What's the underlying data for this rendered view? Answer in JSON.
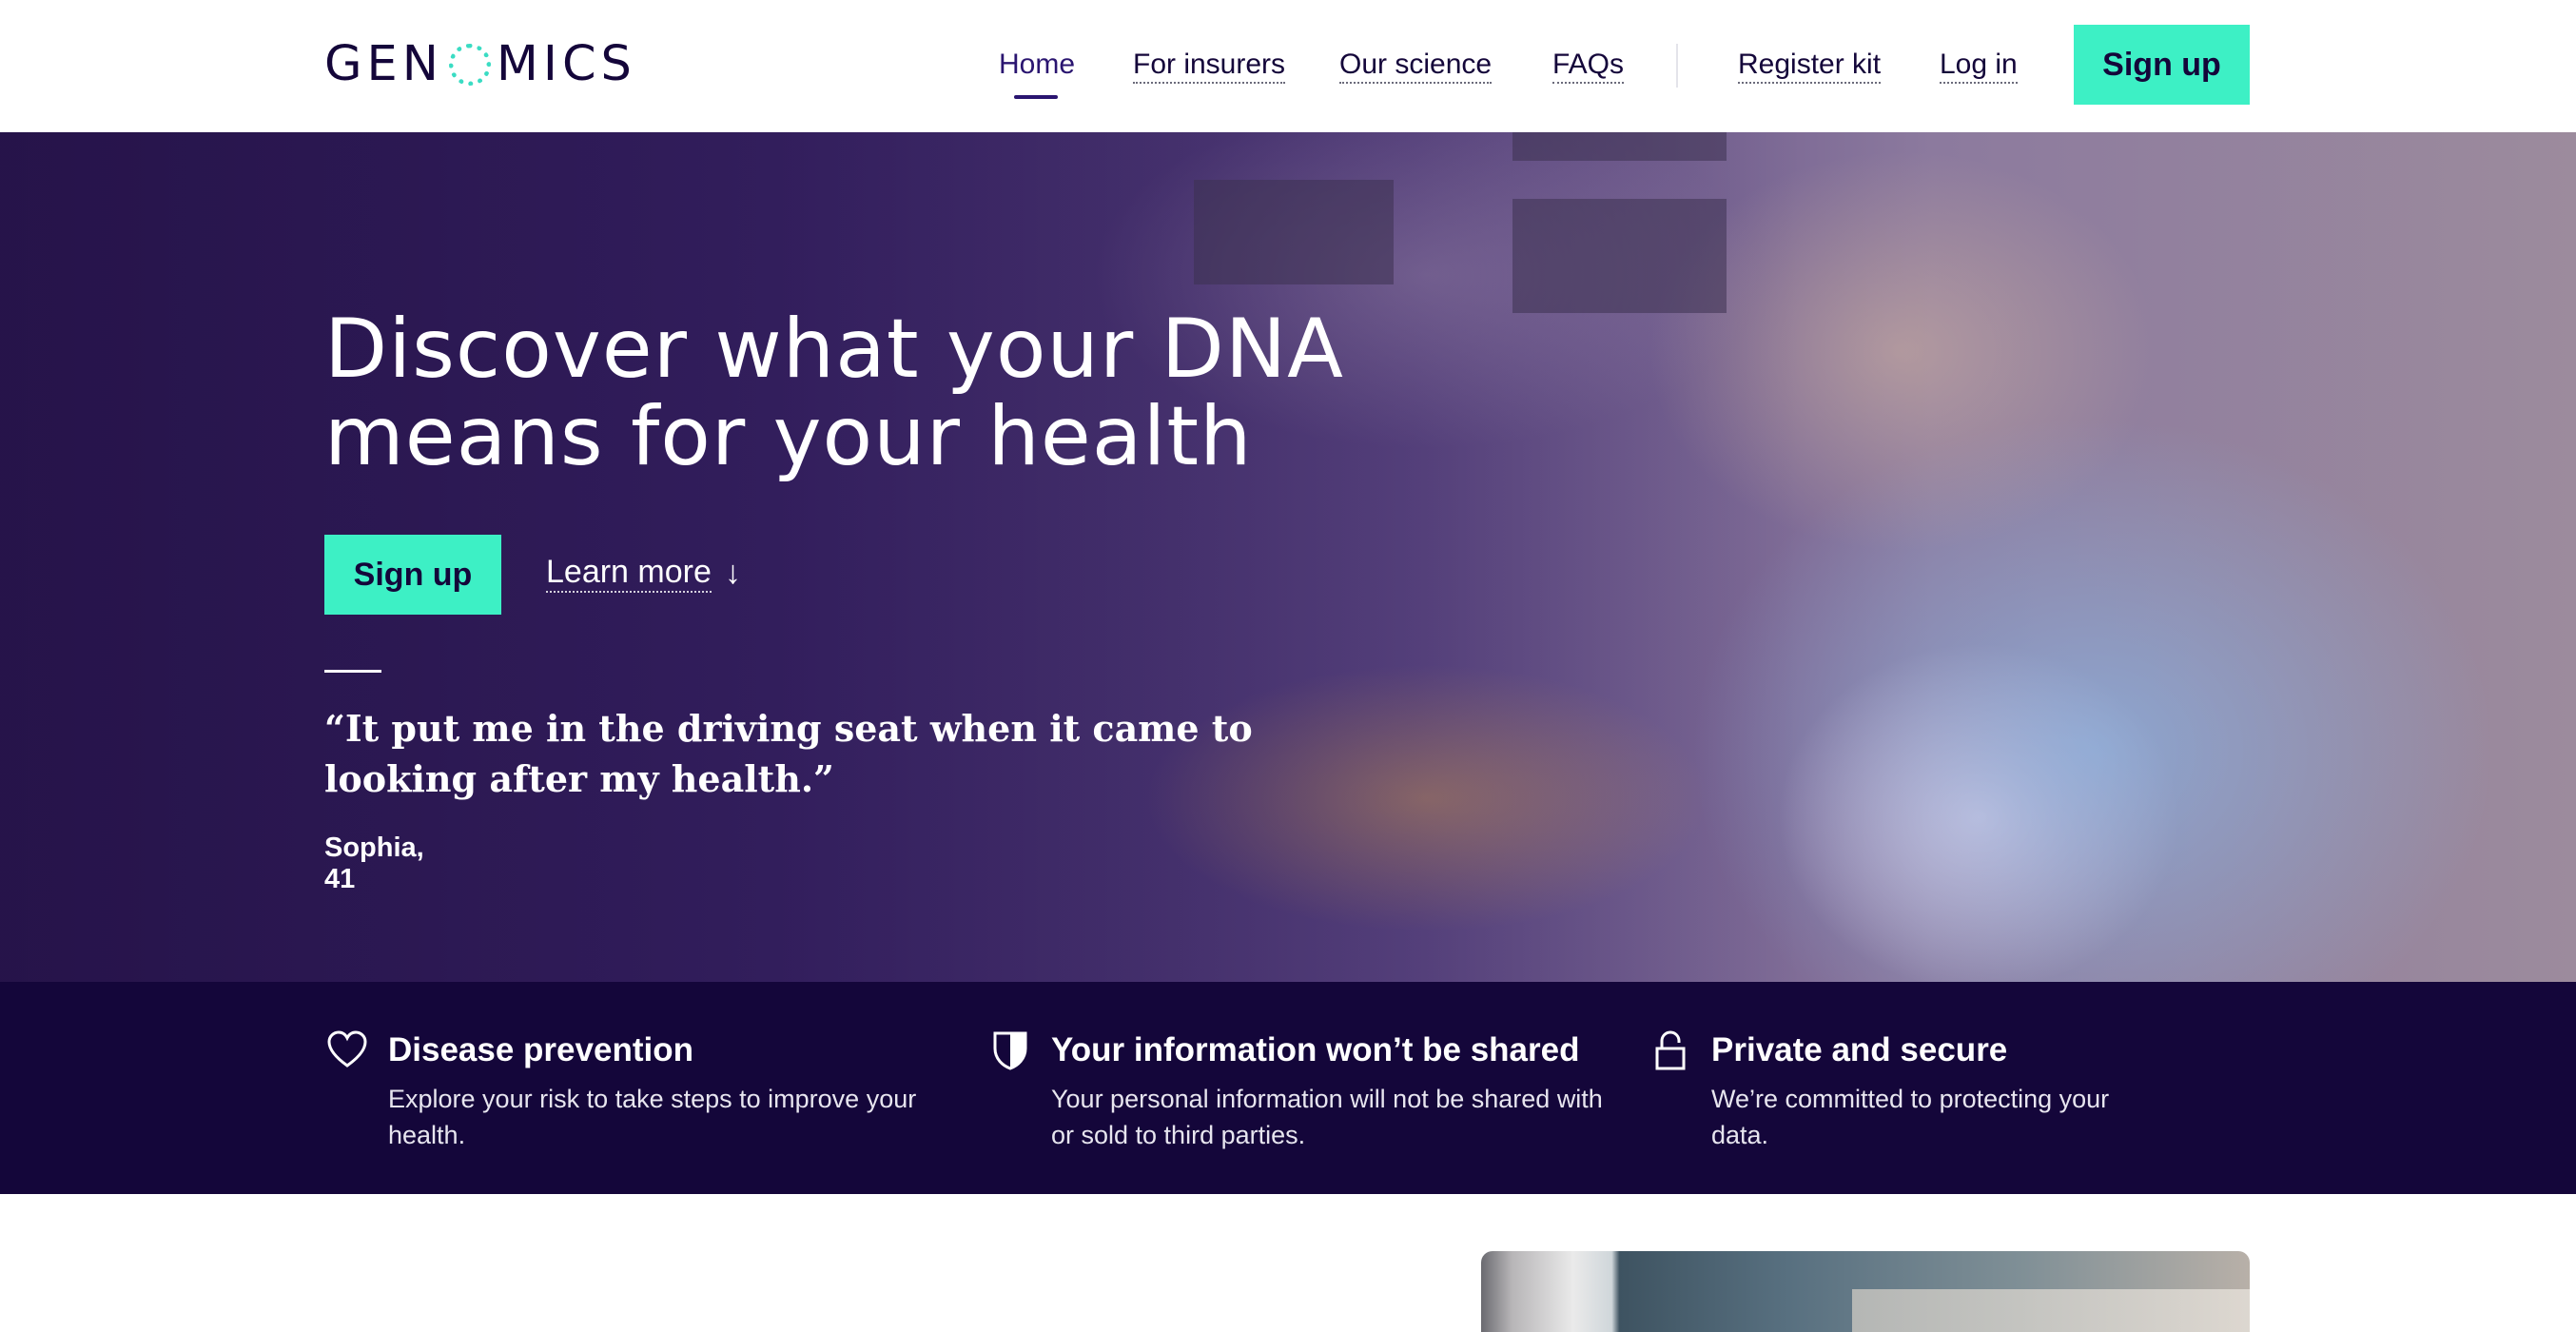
{
  "header": {
    "logo_text_left": "GEN",
    "logo_text_right": "MICS",
    "nav": [
      {
        "label": "Home",
        "active": true
      },
      {
        "label": "For insurers"
      },
      {
        "label": "Our science"
      },
      {
        "label": "FAQs"
      },
      {
        "label": "Register kit"
      },
      {
        "label": "Log in"
      }
    ],
    "signup_label": "Sign up"
  },
  "hero": {
    "title": "Discover what your DNA means for your health",
    "signup_label": "Sign up",
    "learn_more_label": "Learn more",
    "learn_more_icon": "arrow-down-icon",
    "quote": "“It put me in the driving seat when it came to looking after my health.”",
    "author": "Sophia, 41"
  },
  "features": [
    {
      "icon": "heart-icon",
      "title": "Disease prevention",
      "description": "Explore your risk to take steps to improve your health."
    },
    {
      "icon": "shield-icon",
      "title": "Your information won’t be shared",
      "description": "Your personal information will not be shared with or sold to third parties."
    },
    {
      "icon": "lock-icon",
      "title": "Private and secure",
      "description": "We’re committed to protecting your data."
    }
  ],
  "colors": {
    "brand_navy": "#14063a",
    "accent_mint": "#3df0c5",
    "logo_ring": "#3adcc3"
  }
}
